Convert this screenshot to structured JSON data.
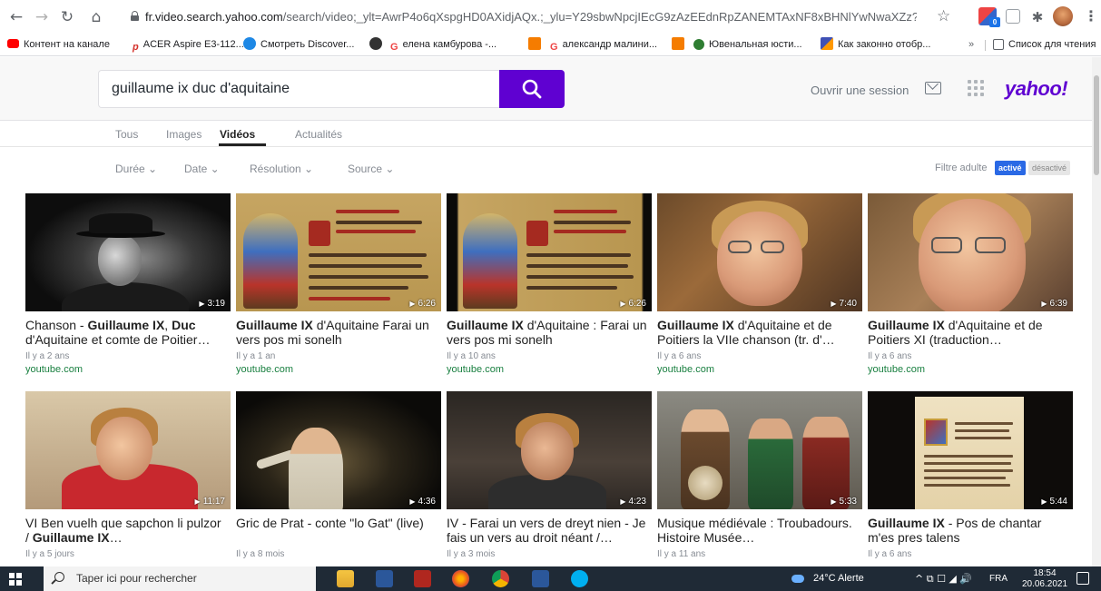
{
  "browser": {
    "url_host": "fr.video.search.yahoo.com",
    "url_rest": "/search/video;_ylt=AwrP4o6qXspgHD0AXidjAQx.;_ylu=Y29sbwNpcjIEcG9zAzEEdnRpZANEMTAxNF8xBHNlYwNwaXZz?p=guillaume...",
    "ext_badge": "0",
    "bookmarks": [
      "Контент на канале",
      "ACER Aspire E3-112...",
      "Смотреть Discover...",
      "",
      "елена камбурова -...",
      "",
      "александр малини...",
      "",
      "Ювенальная юсти...",
      "Как законно отобр..."
    ],
    "bookmarks_more": "»",
    "reading_list": "Список для чтения"
  },
  "header": {
    "search_value": "guillaume ix duc d'aquitaine",
    "signin_label": "Ouvrir une session",
    "logo": "yahoo!"
  },
  "tabs": [
    "Tous",
    "Images",
    "Vidéos",
    "Actualités"
  ],
  "filters": [
    "Durée ⌄",
    "Date ⌄",
    "Résolution ⌄",
    "Source ⌄"
  ],
  "adult_filter": {
    "label": "Filtre adulte",
    "on": "activé",
    "off": "désactivé"
  },
  "videos": [
    {
      "pre": "Chanson - ",
      "bold": "Guillaume IX",
      "post": ", ",
      "bold2": "Duc",
      "post2": " d'Aquitaine et comte de Poitier…",
      "age": "Il y a 2 ans",
      "source": "youtube.com",
      "duration": "3:19"
    },
    {
      "pre": "",
      "bold": "Guillaume IX",
      "post": " d'Aquitaine Farai un vers pos mi sonelh",
      "bold2": "",
      "post2": "",
      "age": "Il y a 1 an",
      "source": "youtube.com",
      "duration": "6:26"
    },
    {
      "pre": "",
      "bold": "Guillaume IX",
      "post": " d'Aquitaine : Farai un vers pos mi sonelh",
      "bold2": "",
      "post2": "",
      "age": "Il y a 10 ans",
      "source": "youtube.com",
      "duration": "6:26"
    },
    {
      "pre": "",
      "bold": "Guillaume IX",
      "post": " d'Aquitaine et de Poitiers la VIIe chanson (tr. d'…",
      "bold2": "",
      "post2": "",
      "age": "Il y a 6 ans",
      "source": "youtube.com",
      "duration": "7:40"
    },
    {
      "pre": "",
      "bold": "Guillaume IX",
      "post": " d'Aquitaine et de Poitiers XI (traduction…",
      "bold2": "",
      "post2": "",
      "age": "Il y a 6 ans",
      "source": "youtube.com",
      "duration": "6:39"
    },
    {
      "pre": "VI Ben vuelh que sapchon li pulzor / ",
      "bold": "Guillaume IX",
      "post": "…",
      "bold2": "",
      "post2": "",
      "age": "Il y a 5 jours",
      "source": "",
      "duration": "11:17"
    },
    {
      "pre": "Gric de Prat - conte \"lo Gat\" (live)",
      "bold": "",
      "post": "",
      "bold2": "",
      "post2": "",
      "age": "Il y a 8 mois",
      "source": "",
      "duration": "4:36"
    },
    {
      "pre": "IV - Farai un vers de dreyt nien - Je fais un vers au droit néant /…",
      "bold": "",
      "post": "",
      "bold2": "",
      "post2": "",
      "age": "Il y a 3 mois",
      "source": "",
      "duration": "4:23"
    },
    {
      "pre": "Musique médiévale : Troubadours. Histoire Musée…",
      "bold": "",
      "post": "",
      "bold2": "",
      "post2": "",
      "age": "Il y a 11 ans",
      "source": "",
      "duration": "5:33"
    },
    {
      "pre": "",
      "bold": "Guillaume IX",
      "post": " - Pos de chantar m'es pres talens",
      "bold2": "",
      "post2": "",
      "age": "Il y a 6 ans",
      "source": "",
      "duration": "5:44"
    }
  ],
  "taskbar": {
    "search_placeholder": "Taper ici pour rechercher",
    "weather": "24°C  Alerte",
    "tray": "^ ⧉ ☐ ◢ 🔊",
    "lang": "FRA",
    "time": "18:54",
    "date": "20.06.2021"
  },
  "colors": {
    "yahoo_purple": "#5f01d1",
    "source_green": "#1a8041",
    "adult_active": "#2a69e5"
  }
}
